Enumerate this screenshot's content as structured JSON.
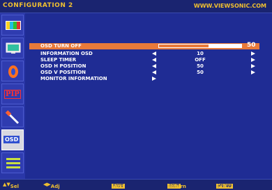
{
  "header": {
    "title": "CONFIGURATION 2",
    "url": "WWW.VIEWSONIC.COM"
  },
  "sidebar": {
    "tabs": [
      {
        "name": "picture",
        "icon": "color-bars-icon"
      },
      {
        "name": "screen",
        "icon": "monitor-icon"
      },
      {
        "name": "audio",
        "icon": "speaker-icon"
      },
      {
        "name": "pip",
        "label": "PIP"
      },
      {
        "name": "setup",
        "icon": "tool-icon"
      },
      {
        "name": "osd",
        "label": "OSD",
        "active": true
      },
      {
        "name": "advanced",
        "icon": "menu-lines-icon"
      }
    ]
  },
  "menu": {
    "osd_turn_off": {
      "label": "OSD TURN OFF",
      "value": "50",
      "level": 0.5
    },
    "information_osd": {
      "label": "INFORMATION OSD",
      "value": "10"
    },
    "sleep_timer": {
      "label": "SLEEP TIMER",
      "value": "OFF"
    },
    "osd_h_position": {
      "label": "OSD H POSITION",
      "value": "50"
    },
    "osd_v_position": {
      "label": "OSD V POSITION",
      "value": "50"
    },
    "monitor_information": {
      "label": "MONITOR INFORMATION"
    }
  },
  "footer": {
    "sel": "Sel",
    "adj": "Adj",
    "next_key": "EXIT",
    "next": "Next",
    "return_key": "EXIT",
    "return": "Return",
    "exit_key": "MENU",
    "exit": "Exit Menu"
  },
  "colors": {
    "background": "#1f2c94",
    "highlight": "#e87a3a",
    "accent_text": "#f0c030"
  }
}
